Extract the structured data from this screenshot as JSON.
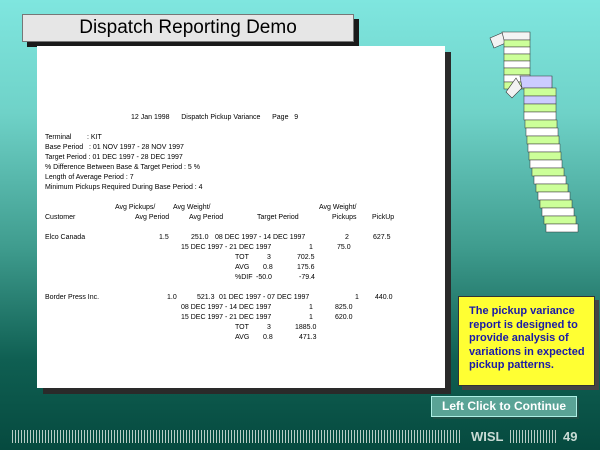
{
  "title": "Dispatch Reporting Demo",
  "report": {
    "header": "12 Jan 1998      Dispatch Pickup Variance      Page   9",
    "params": [
      "Terminal        : KIT",
      "Base Period   : 01 NOV 1997 - 28 NOV 1997",
      "Target Period : 01 DEC 1997 - 28 DEC 1997",
      "% Difference Between Base & Target Period : 5 %",
      "Length of Average Period : 7",
      "Minimum Pickups Required During Base Period : 4"
    ],
    "col_head_1": {
      "pickups": "Avg Pickups/",
      "weight": "Avg Weight/",
      "weight2": "Avg Weight/"
    },
    "col_head_2": {
      "customer": "Customer",
      "avg_period": "Avg Period",
      "avg_period2": "Avg Period",
      "target_period": "Target Period",
      "pickups": "Pickups",
      "pickup": "PickUp"
    },
    "block1": {
      "customer": "Elco Canada",
      "avg_pickups": "1.5",
      "avg_weight": "251.0",
      "rows": [
        {
          "period": "08 DEC 1997 - 14 DEC 1997",
          "pickups": "2",
          "weight": "627.5"
        },
        {
          "period": "15 DEC 1997 - 21 DEC 1997",
          "pickups": "1",
          "weight": "75.0"
        }
      ],
      "tot_label": "TOT",
      "tot_count": "3",
      "tot_value": "702.5",
      "avg_label": "AVG",
      "avg_count": "0.8",
      "avg_value": "175.6",
      "dif_label": "%DIF",
      "dif_count": "-50.0",
      "dif_value": "-79.4"
    },
    "block2": {
      "customer": "Border Press Inc.",
      "avg_pickups": "1.0",
      "avg_weight": "521.3",
      "rows": [
        {
          "period": "01 DEC 1997 - 07 DEC 1997",
          "pickups": "1",
          "weight": "440.0"
        },
        {
          "period": "08 DEC 1997 - 14 DEC 1997",
          "pickups": "1",
          "weight": "825.0"
        },
        {
          "period": "15 DEC 1997 - 21 DEC 1997",
          "pickups": "1",
          "weight": "620.0"
        }
      ],
      "tot_label": "TOT",
      "tot_count": "3",
      "tot_value": "1885.0",
      "avg_label": "AVG",
      "avg_count": "0.8",
      "avg_value": "471.3"
    }
  },
  "callout": "The pickup variance report is designed to provide analysis of variations in expected pickup patterns.",
  "continue_label": "Left Click to Continue",
  "footer": {
    "brand": "WISL",
    "page": "49"
  },
  "colors": {
    "callout_bg": "#ffff33",
    "callout_text": "#1a1aa8",
    "button_bg": "#5aa396"
  }
}
